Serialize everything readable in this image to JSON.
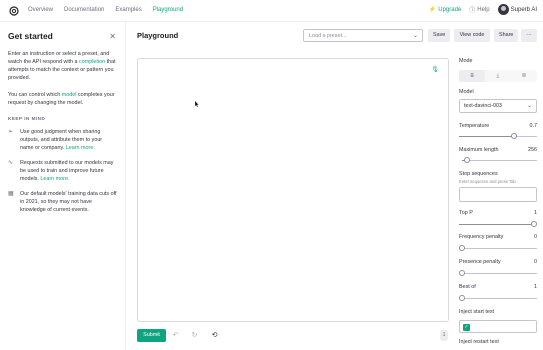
{
  "nav": {
    "links": [
      "Overview",
      "Documentation",
      "Examples",
      "Playground"
    ],
    "active_index": 3,
    "upgrade_label": "Upgrade",
    "help_label": "Help",
    "org_name": "Superb AI"
  },
  "sidebar": {
    "title": "Get started",
    "intro_1": "Enter an instruction or select a preset, and watch the API respond with a ",
    "intro_link": "completion",
    "intro_2": " that attempts to match the context or pattern you provided.",
    "model_text_1": "You can control which ",
    "model_link": "model",
    "model_text_2": " completes your request by changing the model.",
    "keep_in_mind": "KEEP IN MIND",
    "tips": [
      {
        "icon": "send-icon",
        "text": "Use good judgment when sharing outputs, and attribute them to your name or company. ",
        "link": "Learn more."
      },
      {
        "icon": "activity-icon",
        "text": "Requests submitted to our models may be used to train and improve future models. ",
        "link": "Learn more."
      },
      {
        "icon": "calendar-icon",
        "text": "Our default models' training data cuts off in 2021, so they may not have knowledge of current events.",
        "link": ""
      }
    ]
  },
  "playground": {
    "title": "Playground",
    "preset_placeholder": "Load a preset...",
    "save_label": "Save",
    "view_code_label": "View code",
    "share_label": "Share",
    "more_label": "···",
    "submit_label": "Submit",
    "token_count": "1"
  },
  "settings": {
    "mode_label": "Mode",
    "mode_selected": 0,
    "model_label": "Model",
    "model_value": "text-davinci-003",
    "temperature_label": "Temperature",
    "temperature_value": "0.7",
    "temperature_fraction": 0.7,
    "max_length_label": "Maximum length",
    "max_length_value": "256",
    "max_length_fraction": 0.06,
    "stop_label": "Stop sequences",
    "stop_hint": "Enter sequence and press Tab",
    "top_p_label": "Top P",
    "top_p_value": "1",
    "top_p_fraction": 1.0,
    "freq_label": "Frequency penalty",
    "freq_value": "0",
    "freq_fraction": 0.0,
    "presence_label": "Presence penalty",
    "presence_value": "0",
    "presence_fraction": 0.0,
    "best_of_label": "Best of",
    "best_of_value": "1",
    "best_of_fraction": 0.0,
    "inject_start_label": "Inject start text",
    "inject_restart_label": "Inject restart text"
  },
  "colors": {
    "accent": "#10a37f",
    "text": "#353740",
    "muted": "#6e6e80",
    "border": "#c5c5d2"
  }
}
